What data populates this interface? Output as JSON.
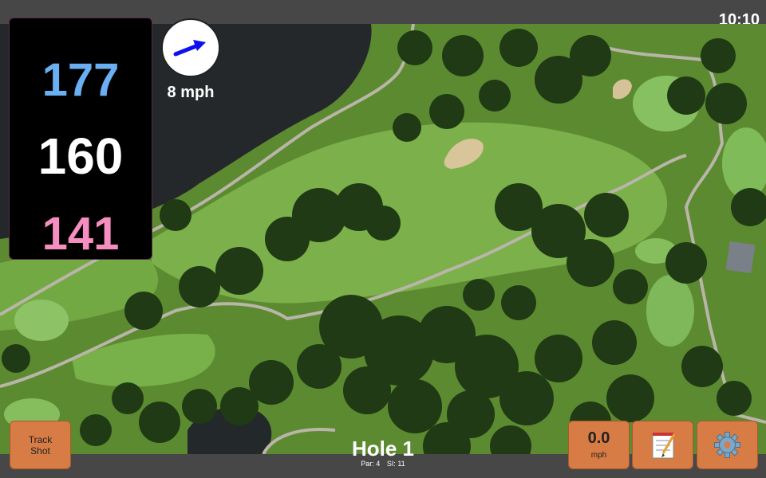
{
  "status": {
    "time": "10:10"
  },
  "distances": {
    "back": "177",
    "center": "160",
    "front": "141"
  },
  "wind": {
    "speed": "8 mph",
    "direction_icon": "arrow-east-northeast-icon",
    "arrow_color": "#1010ee"
  },
  "hole": {
    "title": "Hole 1",
    "par": "Par: 4",
    "si": "SI: 11"
  },
  "buttons": {
    "track_shot": {
      "line1": "Track",
      "line2": "Shot"
    },
    "speed": {
      "value": "0.0",
      "unit": "mph"
    },
    "notes_icon": "notepad-icon",
    "settings_icon": "gear-icon"
  },
  "colors": {
    "back_yardage": "#6aaff2",
    "center_yardage": "#ffffff",
    "front_yardage": "#f68fc0",
    "button_bg": "#d77c45",
    "fairway": "#74a843",
    "rough": "#5c8a30",
    "water": "#25282a",
    "trees": "#1f3a14"
  }
}
